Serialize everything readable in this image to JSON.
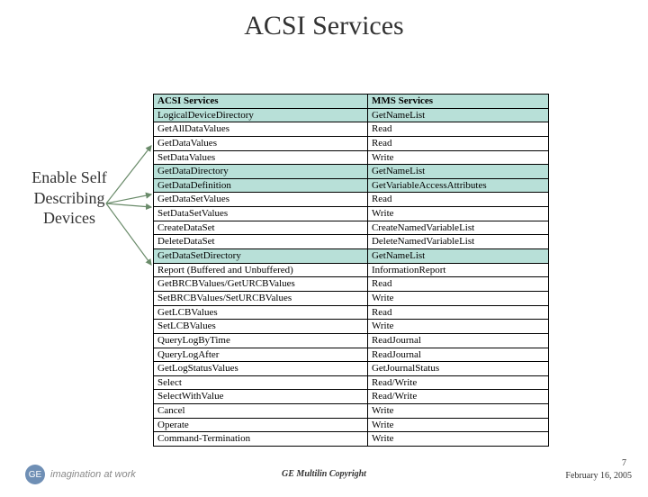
{
  "title": "ACSI Services",
  "callout": "Enable Self Describing Devices",
  "table": {
    "headers": [
      "ACSI Services",
      "MMS Services"
    ],
    "rows": [
      {
        "hl": true,
        "c1": "LogicalDeviceDirectory",
        "c2": "GetNameList"
      },
      {
        "hl": false,
        "c1": "GetAllDataValues",
        "c2": "Read"
      },
      {
        "hl": false,
        "c1": "GetDataValues",
        "c2": "Read"
      },
      {
        "hl": false,
        "c1": "SetDataValues",
        "c2": "Write"
      },
      {
        "hl": true,
        "c1": "GetDataDirectory",
        "c2": "GetNameList"
      },
      {
        "hl": true,
        "c1": "GetDataDefinition",
        "c2": "GetVariableAccessAttributes"
      },
      {
        "hl": false,
        "c1": "GetDataSetValues",
        "c2": "Read"
      },
      {
        "hl": false,
        "c1": "SetDataSetValues",
        "c2": "Write"
      },
      {
        "hl": false,
        "c1": "CreateDataSet",
        "c2": "CreateNamedVariableList"
      },
      {
        "hl": false,
        "c1": "DeleteDataSet",
        "c2": "DeleteNamedVariableList"
      },
      {
        "hl": true,
        "c1": "GetDataSetDirectory",
        "c2": "GetNameList"
      },
      {
        "hl": false,
        "c1": "Report (Buffered and Unbuffered)",
        "c2": "InformationReport"
      },
      {
        "hl": false,
        "c1": "GetBRCBValues/GetURCBValues",
        "c2": "Read"
      },
      {
        "hl": false,
        "c1": "SetBRCBValues/SetURCBValues",
        "c2": "Write"
      },
      {
        "hl": false,
        "c1": "GetLCBValues",
        "c2": "Read"
      },
      {
        "hl": false,
        "c1": "SetLCBValues",
        "c2": "Write"
      },
      {
        "hl": false,
        "c1": "QueryLogByTime",
        "c2": "ReadJournal"
      },
      {
        "hl": false,
        "c1": "QueryLogAfter",
        "c2": "ReadJournal"
      },
      {
        "hl": false,
        "c1": "GetLogStatusValues",
        "c2": "GetJournalStatus"
      },
      {
        "hl": false,
        "c1": "Select",
        "c2": "Read/Write"
      },
      {
        "hl": false,
        "c1": "SelectWithValue",
        "c2": "Read/Write"
      },
      {
        "hl": false,
        "c1": "Cancel",
        "c2": "Write"
      },
      {
        "hl": false,
        "c1": "Operate",
        "c2": "Write"
      },
      {
        "hl": false,
        "c1": "Command-Termination",
        "c2": "Write"
      }
    ]
  },
  "footer": {
    "logo_text": "imagination at work",
    "logo_badge": "GE",
    "copyright": "GE Multilin Copyright",
    "page": "7",
    "date": "February 16, 2005"
  }
}
